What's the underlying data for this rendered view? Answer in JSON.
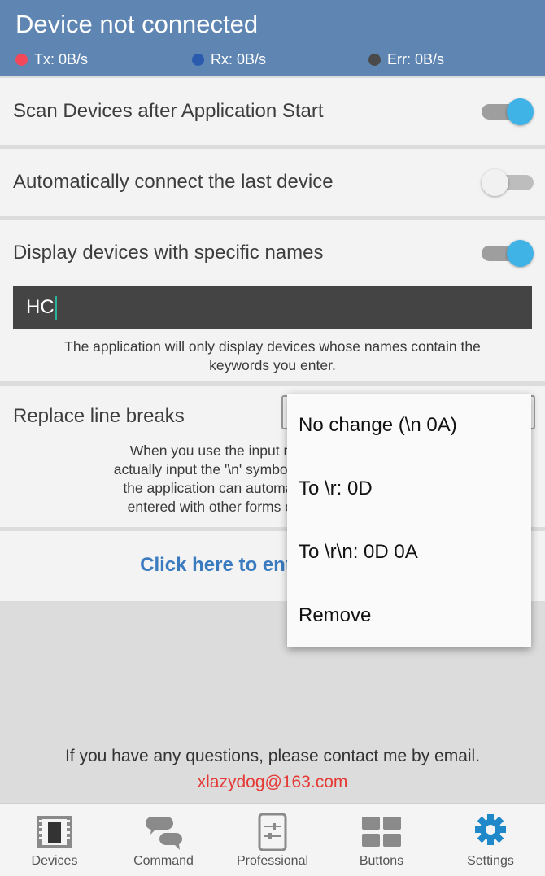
{
  "header": {
    "title": "Device not connected",
    "tx": "Tx: 0B/s",
    "rx": "Rx: 0B/s",
    "err": "Err: 0B/s",
    "colors": {
      "bar": "#5f86b3",
      "tx_dot": "#f2485a",
      "rx_dot": "#2a5aad",
      "err_dot": "#4a4a4a"
    }
  },
  "settings": {
    "scan_on_start": {
      "label": "Scan Devices after Application Start",
      "enabled": true
    },
    "auto_connect": {
      "label": "Automatically connect the last device",
      "enabled": false
    },
    "filter_names": {
      "label": "Display devices with specific names",
      "enabled": true,
      "value": "HC",
      "help_line1": "The application will only display devices whose names contain the",
      "help_line2": "keywords you enter."
    },
    "line_breaks": {
      "label": "Replace line breaks",
      "help_line1": "When you use the input method to",
      "help_line2": "actually input the '\\n' symbol, whose by",
      "help_line3": "the application can automatically re",
      "help_line4": "entered with other forms of newlin"
    },
    "link_text": "Click here to enter my"
  },
  "dropdown": {
    "options": [
      "No change (\\n 0A)",
      "To \\r: 0D",
      "To \\r\\n: 0D 0A",
      "Remove"
    ]
  },
  "contact": {
    "text": "If you have any questions, please contact me by email.",
    "email": "xlazydog@163.com"
  },
  "nav": {
    "tabs": [
      {
        "label": "Devices",
        "icon": "device-chip-icon"
      },
      {
        "label": "Command",
        "icon": "chat-bubbles-icon"
      },
      {
        "label": "Professional",
        "icon": "phone-sliders-icon"
      },
      {
        "label": "Buttons",
        "icon": "grid-buttons-icon"
      },
      {
        "label": "Settings",
        "icon": "gear-icon"
      }
    ],
    "active": "Settings",
    "active_color": "#1e88c8"
  }
}
